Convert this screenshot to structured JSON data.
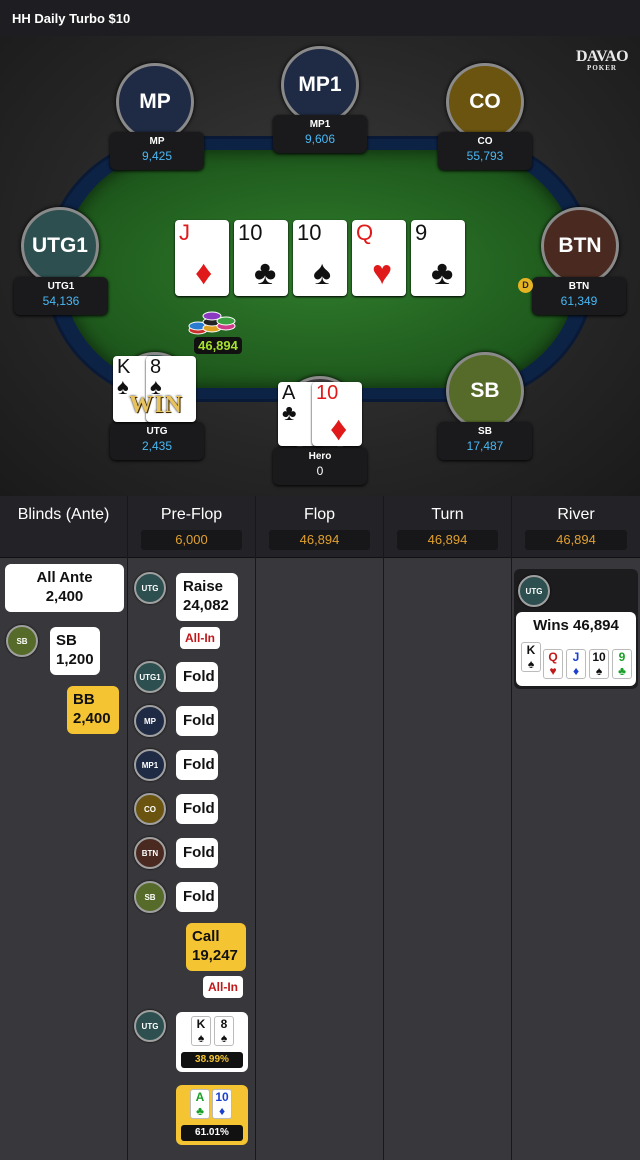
{
  "header": {
    "title": "HH  Daily Turbo $10"
  },
  "logo": {
    "text": "DAVAO",
    "sub": "POKER"
  },
  "table": {
    "pot": "46,894",
    "dealer": "D",
    "win_badge": "WIN",
    "seats": [
      {
        "id": "mp",
        "avatar": "MP",
        "name": "MP",
        "stack": "9,425",
        "color": "#1f2a44"
      },
      {
        "id": "mp1",
        "avatar": "MP1",
        "name": "MP1",
        "stack": "9,606",
        "color": "#1f2a44"
      },
      {
        "id": "co",
        "avatar": "CO",
        "name": "CO",
        "stack": "55,793",
        "color": "#6a5410"
      },
      {
        "id": "utg1",
        "avatar": "UTG1",
        "name": "UTG1",
        "stack": "54,136",
        "color": "#2d4f4f"
      },
      {
        "id": "btn",
        "avatar": "BTN",
        "name": "BTN",
        "stack": "61,349",
        "color": "#4a2a20"
      },
      {
        "id": "utg",
        "avatar": "",
        "name": "UTG",
        "stack": "2,435",
        "color": "#2d4f4f"
      },
      {
        "id": "hero",
        "avatar": "",
        "name": "Hero",
        "stack": "0",
        "color": "#3a3a3a"
      },
      {
        "id": "sb",
        "avatar": "SB",
        "name": "SB",
        "stack": "17,487",
        "color": "#566b2a"
      }
    ],
    "board": [
      {
        "rank": "J",
        "suit": "♦",
        "color": "red"
      },
      {
        "rank": "10",
        "suit": "♣",
        "color": "blk"
      },
      {
        "rank": "10",
        "suit": "♠",
        "color": "blk"
      },
      {
        "rank": "Q",
        "suit": "♥",
        "color": "red"
      },
      {
        "rank": "9",
        "suit": "♣",
        "color": "blk"
      }
    ],
    "utg_cards": [
      {
        "rank": "K",
        "suit": "♠",
        "color": "blk"
      },
      {
        "rank": "8",
        "suit": "♠",
        "color": "blk"
      }
    ],
    "hero_cards": [
      {
        "rank": "A",
        "suit": "♣",
        "color": "blk"
      },
      {
        "rank": "10",
        "suit": "♦",
        "color": "red"
      }
    ]
  },
  "columns": [
    {
      "title": "Blinds (Ante)",
      "pot": ""
    },
    {
      "title": "Pre-Flop",
      "pot": "6,000"
    },
    {
      "title": "Flop",
      "pot": "46,894"
    },
    {
      "title": "Turn",
      "pot": "46,894"
    },
    {
      "title": "River",
      "pot": "46,894"
    }
  ],
  "blinds": {
    "ante_label": "All Ante",
    "ante_value": "2,400",
    "sb_chip": "SB",
    "sb_label": "SB",
    "sb_value": "1,200",
    "bb_label": "BB",
    "bb_value": "2,400"
  },
  "preflop": {
    "raise_chip": "UTG",
    "raise_label": "Raise",
    "raise_value": "24,082",
    "allin_1": "All-In",
    "folds": [
      {
        "chip": "UTG1",
        "label": "Fold",
        "color": "#2d4f4f"
      },
      {
        "chip": "MP",
        "label": "Fold",
        "color": "#1f2a44"
      },
      {
        "chip": "MP1",
        "label": "Fold",
        "color": "#1f2a44"
      },
      {
        "chip": "CO",
        "label": "Fold",
        "color": "#6a5410"
      },
      {
        "chip": "BTN",
        "label": "Fold",
        "color": "#4a2a20"
      },
      {
        "chip": "SB",
        "label": "Fold",
        "color": "#566b2a"
      }
    ],
    "call_label": "Call",
    "call_value": "19,247",
    "allin_2": "All-In",
    "show_chip": "UTG",
    "utg_show": [
      {
        "rank": "K",
        "suit": "♠",
        "color": "blk"
      },
      {
        "rank": "8",
        "suit": "♠",
        "color": "blk"
      }
    ],
    "utg_equity": "38.99%",
    "hero_show": [
      {
        "rank": "A",
        "suit": "♣",
        "color": "#1aa028"
      },
      {
        "rank": "10",
        "suit": "♦",
        "color": "#1a40d0"
      }
    ],
    "hero_equity": "61.01%"
  },
  "river": {
    "chip": "UTG",
    "wins_label": "Wins 46,894",
    "cards": [
      {
        "rank": "K",
        "suit": "♠",
        "color": "#111"
      },
      {
        "rank": "Q",
        "suit": "♥",
        "color": "#c01818"
      },
      {
        "rank": "J",
        "suit": "♦",
        "color": "#1a40d0"
      },
      {
        "rank": "10",
        "suit": "♠",
        "color": "#111"
      },
      {
        "rank": "9",
        "suit": "♣",
        "color": "#1aa028"
      }
    ]
  }
}
